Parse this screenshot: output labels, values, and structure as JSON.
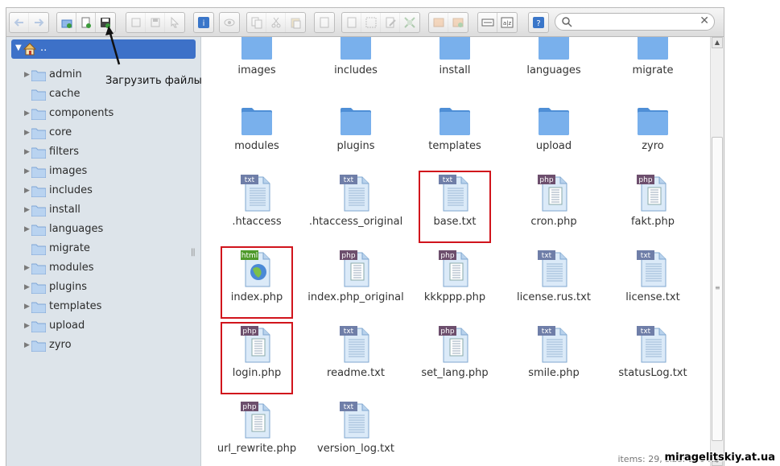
{
  "toolbar": {
    "groups": [
      [
        "back-icon",
        "forward-icon"
      ],
      [
        "new-folder-icon",
        "new-file-icon",
        "upload-icon"
      ],
      [
        "open-icon",
        "download-icon",
        "select-icon"
      ],
      [
        "info-icon"
      ],
      [
        "quicklook-icon"
      ],
      [
        "copy-icon",
        "cut-icon",
        "paste-icon"
      ],
      [
        "duplicate-icon"
      ],
      [
        "extract-icon",
        "rename-icon",
        "edit-icon",
        "resize-icon"
      ],
      [
        "archive-icon",
        "extract-archive-icon"
      ],
      [
        "view-icons-icon",
        "sort-icon"
      ],
      [
        "help-icon"
      ]
    ]
  },
  "search": {
    "value": "",
    "placeholder": "",
    "clear_label": "✕"
  },
  "tree": {
    "root_label": "..",
    "items": [
      {
        "label": "admin",
        "expandable": true
      },
      {
        "label": "cache",
        "expandable": false
      },
      {
        "label": "components",
        "expandable": true
      },
      {
        "label": "core",
        "expandable": true
      },
      {
        "label": "filters",
        "expandable": true
      },
      {
        "label": "images",
        "expandable": true
      },
      {
        "label": "includes",
        "expandable": true
      },
      {
        "label": "install",
        "expandable": true
      },
      {
        "label": "languages",
        "expandable": true
      },
      {
        "label": "migrate",
        "expandable": false
      },
      {
        "label": "modules",
        "expandable": true
      },
      {
        "label": "plugins",
        "expandable": true
      },
      {
        "label": "templates",
        "expandable": true
      },
      {
        "label": "upload",
        "expandable": true
      },
      {
        "label": "zyro",
        "expandable": true
      }
    ]
  },
  "files": [
    {
      "name": "images",
      "type": "folder"
    },
    {
      "name": "includes",
      "type": "folder"
    },
    {
      "name": "install",
      "type": "folder"
    },
    {
      "name": "languages",
      "type": "folder"
    },
    {
      "name": "migrate",
      "type": "folder"
    },
    {
      "name": "modules",
      "type": "folder"
    },
    {
      "name": "plugins",
      "type": "folder"
    },
    {
      "name": "templates",
      "type": "folder"
    },
    {
      "name": "upload",
      "type": "folder"
    },
    {
      "name": "zyro",
      "type": "folder"
    },
    {
      "name": ".htaccess",
      "type": "txt",
      "badge": "txt"
    },
    {
      "name": ".htaccess_original",
      "type": "txt",
      "badge": "txt"
    },
    {
      "name": "base.txt",
      "type": "txt",
      "badge": "txt",
      "highlight": true
    },
    {
      "name": "cron.php",
      "type": "php",
      "badge": "php"
    },
    {
      "name": "fakt.php",
      "type": "php",
      "badge": "php"
    },
    {
      "name": "index.php",
      "type": "html",
      "badge": "html",
      "highlight": true
    },
    {
      "name": "index.php_original",
      "type": "php",
      "badge": "php"
    },
    {
      "name": "kkkppp.php",
      "type": "php",
      "badge": "php"
    },
    {
      "name": "license.rus.txt",
      "type": "txt",
      "badge": "txt"
    },
    {
      "name": "license.txt",
      "type": "txt",
      "badge": "txt"
    },
    {
      "name": "login.php",
      "type": "php",
      "badge": "php",
      "highlight": true
    },
    {
      "name": "readme.txt",
      "type": "txt",
      "badge": "txt"
    },
    {
      "name": "set_lang.php",
      "type": "php",
      "badge": "php"
    },
    {
      "name": "smile.php",
      "type": "txt",
      "badge": "txt"
    },
    {
      "name": "statusLog.txt",
      "type": "txt",
      "badge": "txt"
    },
    {
      "name": "url_rewrite.php",
      "type": "php",
      "badge": "php"
    },
    {
      "name": "version_log.txt",
      "type": "txt",
      "badge": "txt"
    }
  ],
  "status": "items: 29, size: 916 KB",
  "annotation": "Загрузить файлы",
  "watermark": "miragelitskiy.at.ua",
  "colors": {
    "tree_selected": "#3d71c8",
    "highlight_box": "#d1141c",
    "sidebar_bg": "#dde4ea",
    "folder": "#5b9be0"
  }
}
